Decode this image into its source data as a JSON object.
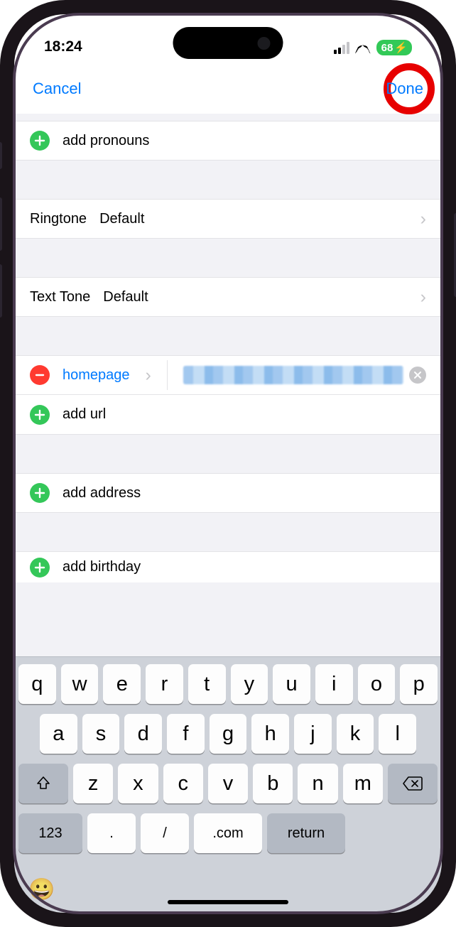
{
  "status": {
    "time": "18:24",
    "battery": "68"
  },
  "nav": {
    "cancel": "Cancel",
    "done": "Done"
  },
  "rows": {
    "add_pronouns": "add pronouns",
    "ringtone_label": "Ringtone",
    "ringtone_value": "Default",
    "texttone_label": "Text Tone",
    "texttone_value": "Default",
    "homepage_label": "homepage",
    "add_url": "add url",
    "add_address": "add address",
    "add_birthday": "add birthday"
  },
  "keyboard": {
    "row1": [
      "q",
      "w",
      "e",
      "r",
      "t",
      "y",
      "u",
      "i",
      "o",
      "p"
    ],
    "row2": [
      "a",
      "s",
      "d",
      "f",
      "g",
      "h",
      "j",
      "k",
      "l"
    ],
    "row3": [
      "z",
      "x",
      "c",
      "v",
      "b",
      "n",
      "m"
    ],
    "k123": "123",
    "dot": ".",
    "slash": "/",
    "com": ".com",
    "return": "return"
  }
}
